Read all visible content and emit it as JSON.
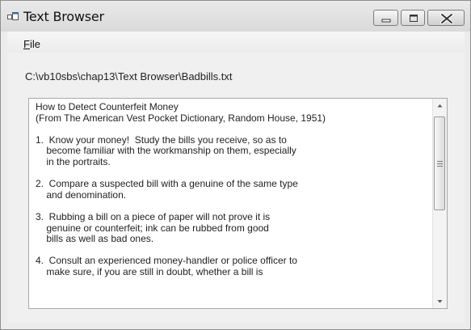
{
  "window": {
    "title": "Text Browser",
    "icon": "app-window-icon"
  },
  "titlebar_buttons": {
    "minimize": "minimize-icon",
    "maximize": "maximize-icon",
    "close": "close-icon"
  },
  "menu": {
    "file_accel": "F",
    "file_rest": "ile"
  },
  "path_label": "C:\\vb10sbs\\chap13\\Text Browser\\Badbills.txt",
  "textbox": {
    "lines": [
      "How to Detect Counterfeit Money",
      "(From The American Vest Pocket Dictionary, Random House, 1951)",
      "",
      "1.  Know your money!  Study the bills you receive, so as to",
      "    become familiar with the workmanship on them, especially",
      "    in the portraits.",
      "",
      "2.  Compare a suspected bill with a genuine of the same type",
      "    and denomination.",
      "",
      "3.  Rubbing a bill on a piece of paper will not prove it is",
      "    genuine or counterfeit; ink can be rubbed from good",
      "    bills as well as bad ones.",
      "",
      "4.  Consult an experienced money-handler or police officer to",
      "    make sure, if you are still in doubt, whether a bill is"
    ]
  },
  "scrollbar": {
    "up": "scroll-up-arrow-icon",
    "down": "scroll-down-arrow-icon",
    "grip": "scroll-grip-icon"
  }
}
